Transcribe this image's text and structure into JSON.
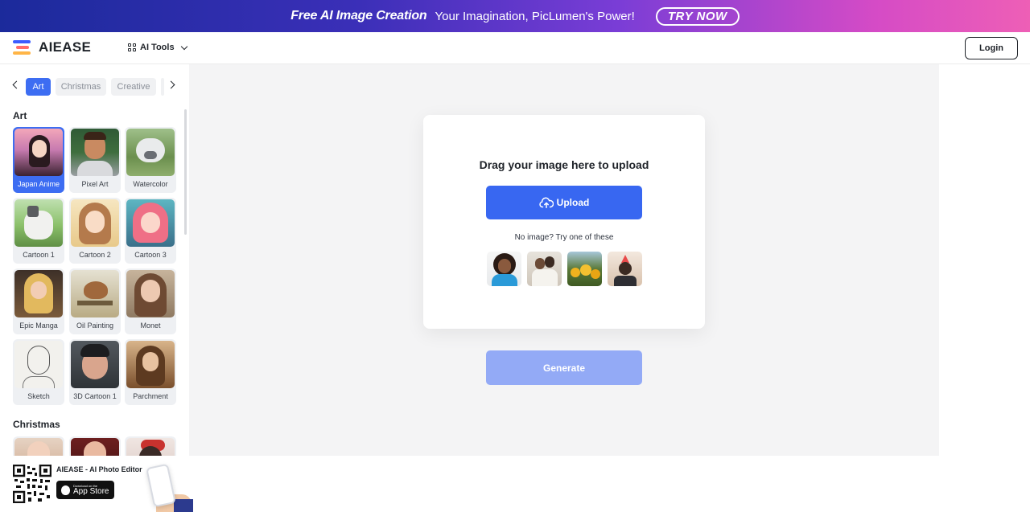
{
  "banner": {
    "highlight": "Free AI Image Creation",
    "tagline": "Your Imagination, PicLumen's Power!",
    "cta": "TRY NOW"
  },
  "header": {
    "logo_text": "AIEASE",
    "ai_tools_label": "AI Tools",
    "login_label": "Login"
  },
  "sidebar": {
    "tabs": [
      "Art",
      "Christmas",
      "Creative"
    ],
    "active_tab": "Art",
    "sections": [
      {
        "title": "Art",
        "items": [
          {
            "label": "Japan Anime",
            "active": true
          },
          {
            "label": "Pixel Art"
          },
          {
            "label": "Watercolor"
          },
          {
            "label": "Cartoon 1"
          },
          {
            "label": "Cartoon 2"
          },
          {
            "label": "Cartoon 3"
          },
          {
            "label": "Epic Manga"
          },
          {
            "label": "Oil Painting"
          },
          {
            "label": "Monet"
          },
          {
            "label": "Sketch"
          },
          {
            "label": "3D Cartoon 1"
          },
          {
            "label": "Parchment"
          }
        ]
      },
      {
        "title": "Christmas"
      }
    ]
  },
  "main": {
    "drag_text": "Drag your image here to upload",
    "upload_label": "Upload",
    "no_image_text": "No image? Try one of these",
    "generate_label": "Generate",
    "accent_color": "#3867f1",
    "disabled_color": "#93aaf6"
  },
  "promo": {
    "title": "AIEASE - AI Photo Editor",
    "store_small": "Download on the",
    "store_big": "App Store"
  }
}
